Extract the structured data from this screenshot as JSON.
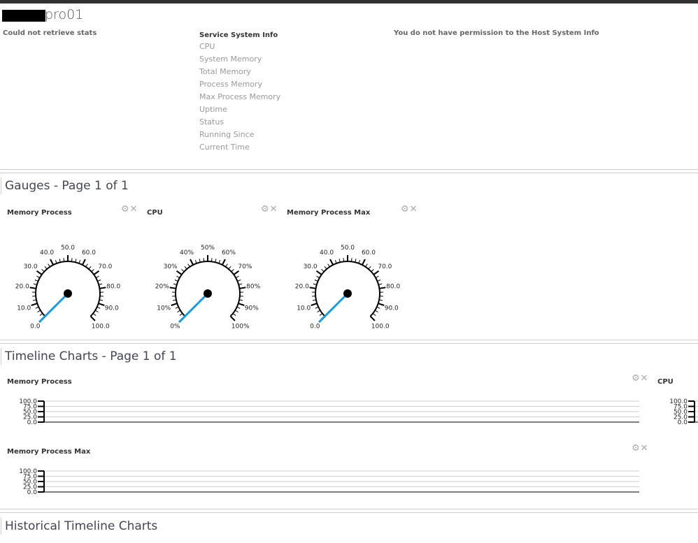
{
  "header": {
    "host_suffix": "pro01",
    "stats_error": "Could not retrieve stats",
    "host_permission": "You do not have permission to the Host System Info"
  },
  "service_info": {
    "title": "Service System Info",
    "items": [
      "CPU",
      "System Memory",
      "Total Memory",
      "Process Memory",
      "Max Process Memory",
      "Uptime",
      "Status",
      "Running Since",
      "Current Time"
    ]
  },
  "gauges_section": {
    "title": "Gauges - Page 1 of 1"
  },
  "gauges": [
    {
      "title": "Memory Process",
      "labels": [
        "0.0",
        "10.0",
        "20.0",
        "30.0",
        "40.0",
        "50.0",
        "60.0",
        "70.0",
        "80.0",
        "90.0",
        "100.0"
      ],
      "value": 0
    },
    {
      "title": "CPU",
      "labels": [
        "0%",
        "10%",
        "20%",
        "30%",
        "40%",
        "50%",
        "60%",
        "70%",
        "80%",
        "90%",
        "100%"
      ],
      "value": 0
    },
    {
      "title": "Memory Process Max",
      "labels": [
        "0.0",
        "10.0",
        "20.0",
        "30.0",
        "40.0",
        "50.0",
        "60.0",
        "70.0",
        "80.0",
        "90.0",
        "100.0"
      ],
      "value": 0
    }
  ],
  "timeline_section": {
    "title": "Timeline Charts - Page 1 of 1"
  },
  "timelines": [
    {
      "title": "Memory Process",
      "y_ticks": [
        "100.0",
        "75.0",
        "50.0",
        "25.0",
        "0.0"
      ]
    },
    {
      "title": "CPU",
      "y_ticks": [
        "100.0",
        "75.0",
        "50.0",
        "25.0",
        "0.0"
      ]
    },
    {
      "title": "Memory Process Max",
      "y_ticks": [
        "100.0",
        "75.0",
        "50.0",
        "25.0",
        "0.0"
      ]
    }
  ],
  "historical_section": {
    "title": "Historical Timeline Charts"
  },
  "icons": {
    "settings": "gear-icon",
    "close": "close-icon"
  },
  "colors": {
    "needle": "#1a9bd7"
  }
}
